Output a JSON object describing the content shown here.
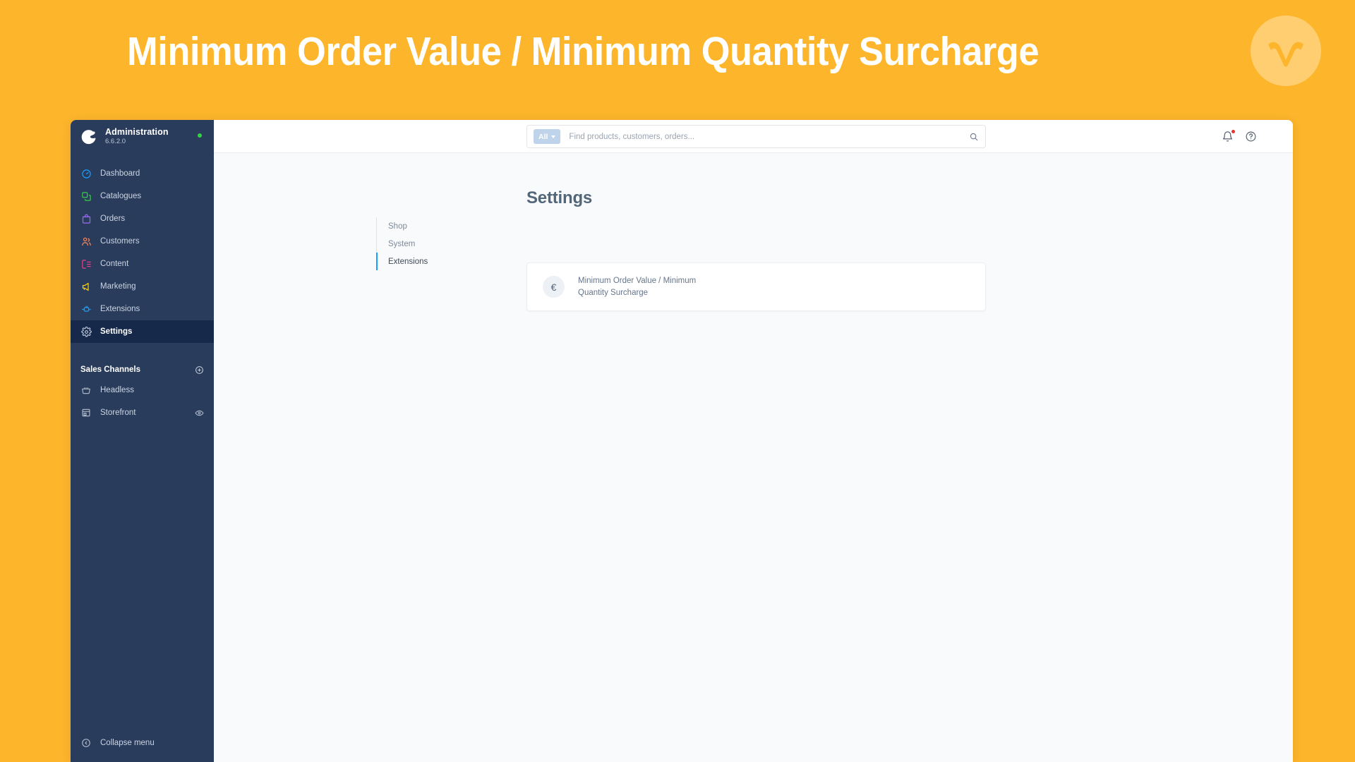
{
  "banner": {
    "title": "Minimum Order Value / Minimum Quantity Surcharge",
    "logo_icon": "wave-w-logo",
    "bg_color": "#FDB52B",
    "logo_circle_color": "#FFCE71",
    "title_color": "#FFFFFF"
  },
  "sidebar": {
    "logo_icon": "shopware-logo",
    "title": "Administration",
    "version": "6.6.2.0",
    "status_dot_color": "#37D046",
    "items": [
      {
        "label": "Dashboard",
        "icon": "dashboard-gauge-icon",
        "color": "#189EFF",
        "active": false
      },
      {
        "label": "Catalogues",
        "icon": "catalogue-copy-icon",
        "color": "#37D046",
        "active": false
      },
      {
        "label": "Orders",
        "icon": "orders-bag-icon",
        "color": "#9B6BF5",
        "active": false
      },
      {
        "label": "Customers",
        "icon": "customers-people-icon",
        "color": "#F88962",
        "active": false
      },
      {
        "label": "Content",
        "icon": "content-layout-icon",
        "color": "#EE3D8C",
        "active": false
      },
      {
        "label": "Marketing",
        "icon": "marketing-megaphone-icon",
        "color": "#FFD700",
        "active": false
      },
      {
        "label": "Extensions",
        "icon": "extensions-plug-icon",
        "color": "#189EFF",
        "active": false
      },
      {
        "label": "Settings",
        "icon": "settings-gear-icon",
        "color": "#C2CDDC",
        "active": true
      }
    ],
    "sales_channels": {
      "heading": "Sales Channels",
      "add_icon": "plus-circle-icon",
      "items": [
        {
          "label": "Headless",
          "icon": "headless-basket-icon",
          "trailing_icon": ""
        },
        {
          "label": "Storefront",
          "icon": "storefront-shop-icon",
          "trailing_icon": "eye-icon"
        }
      ]
    },
    "collapse": {
      "label": "Collapse menu",
      "icon": "chevron-left-circle-icon"
    }
  },
  "topbar": {
    "search": {
      "scope_label": "All",
      "scope_caret_icon": "chevron-down-icon",
      "placeholder": "Find products, customers, orders...",
      "value": "",
      "search_icon": "search-icon"
    },
    "actions": [
      {
        "name": "notifications",
        "icon": "bell-icon",
        "has_badge": true,
        "badge_color": "#E3342F"
      },
      {
        "name": "help",
        "icon": "help-circle-icon",
        "has_badge": false
      }
    ]
  },
  "content": {
    "page_title": "Settings",
    "tabs": [
      {
        "label": "Shop",
        "active": false
      },
      {
        "label": "System",
        "active": false
      },
      {
        "label": "Extensions",
        "active": true
      }
    ],
    "active_tab_accent": "#189EFF",
    "cards": [
      {
        "icon": "euro-currency-icon",
        "icon_glyph": "€",
        "label_line1": "Minimum Order Value / Minimum",
        "label_line2": "Quantity Surcharge"
      }
    ]
  }
}
